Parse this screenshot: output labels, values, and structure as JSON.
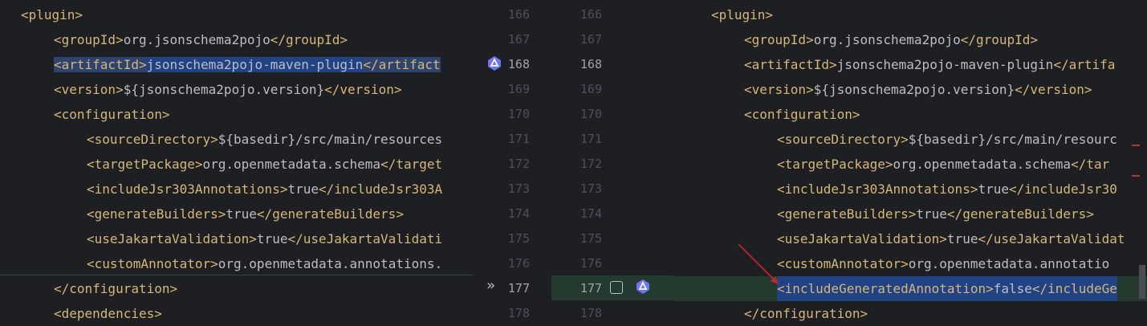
{
  "left": {
    "lines": [
      {
        "parts": [
          [
            "tag",
            "<plugin>"
          ]
        ]
      },
      {
        "parts": [
          [
            "tag",
            "<groupId>"
          ],
          [
            "text",
            "org.jsonschema2pojo"
          ],
          [
            "tag",
            "</groupId>"
          ]
        ]
      },
      {
        "parts": [
          [
            "tag",
            "<artifactId>"
          ],
          [
            "text",
            "jsonschema2pojo-maven-plugin"
          ],
          [
            "tag",
            "</artifact"
          ]
        ]
      },
      {
        "parts": [
          [
            "tag",
            "<version>"
          ],
          [
            "text",
            "${jsonschema2pojo.version}"
          ],
          [
            "tag",
            "</version>"
          ]
        ]
      },
      {
        "parts": [
          [
            "tag",
            "<configuration>"
          ]
        ]
      },
      {
        "parts": [
          [
            "tag",
            "<sourceDirectory>"
          ],
          [
            "text",
            "${basedir}/src/main/resources"
          ]
        ]
      },
      {
        "parts": [
          [
            "tag",
            "<targetPackage>"
          ],
          [
            "text",
            "org.openmetadata.schema"
          ],
          [
            "tag",
            "</target"
          ]
        ]
      },
      {
        "parts": [
          [
            "tag",
            "<includeJsr303Annotations>"
          ],
          [
            "text",
            "true"
          ],
          [
            "tag",
            "</includeJsr303A"
          ]
        ]
      },
      {
        "parts": [
          [
            "tag",
            "<generateBuilders>"
          ],
          [
            "text",
            "true"
          ],
          [
            "tag",
            "</generateBuilders>"
          ]
        ]
      },
      {
        "parts": [
          [
            "tag",
            "<useJakartaValidation>"
          ],
          [
            "text",
            "true"
          ],
          [
            "tag",
            "</useJakartaValidati"
          ]
        ]
      },
      {
        "parts": [
          [
            "tag",
            "<customAnnotator>"
          ],
          [
            "text",
            "org.openmetadata.annotations."
          ]
        ]
      },
      {
        "parts": [
          [
            "tag",
            "</configuration>"
          ]
        ]
      },
      {
        "parts": [
          [
            "tag",
            "<dependencies>"
          ]
        ]
      }
    ]
  },
  "right": {
    "lines": [
      {
        "parts": [
          [
            "tag",
            "<plugin>"
          ]
        ]
      },
      {
        "parts": [
          [
            "tag",
            "<groupId>"
          ],
          [
            "text",
            "org.jsonschema2pojo"
          ],
          [
            "tag",
            "</groupId>"
          ]
        ]
      },
      {
        "parts": [
          [
            "tag",
            "<artifactId>"
          ],
          [
            "text",
            "jsonschema2pojo-maven-plugin"
          ],
          [
            "tag",
            "</artifa"
          ]
        ]
      },
      {
        "parts": [
          [
            "tag",
            "<version>"
          ],
          [
            "text",
            "${jsonschema2pojo.version}"
          ],
          [
            "tag",
            "</version>"
          ]
        ]
      },
      {
        "parts": [
          [
            "tag",
            "<configuration>"
          ]
        ]
      },
      {
        "parts": [
          [
            "tag",
            "<sourceDirectory>"
          ],
          [
            "text",
            "${basedir}/src/main/resourc"
          ]
        ]
      },
      {
        "parts": [
          [
            "tag",
            "<targetPackage>"
          ],
          [
            "text",
            "org.openmetadata.schema"
          ],
          [
            "tag",
            "</tar"
          ]
        ]
      },
      {
        "parts": [
          [
            "tag",
            "<includeJsr303Annotations>"
          ],
          [
            "text",
            "true"
          ],
          [
            "tag",
            "</includeJsr30"
          ]
        ]
      },
      {
        "parts": [
          [
            "tag",
            "<generateBuilders>"
          ],
          [
            "text",
            "true"
          ],
          [
            "tag",
            "</generateBuilders>"
          ]
        ]
      },
      {
        "parts": [
          [
            "tag",
            "<useJakartaValidation>"
          ],
          [
            "text",
            "true"
          ],
          [
            "tag",
            "</useJakartaValidat"
          ]
        ]
      },
      {
        "parts": [
          [
            "tag",
            "<customAnnotator>"
          ],
          [
            "text",
            "org.openmetadata.annotatio"
          ]
        ]
      },
      {
        "parts": [
          [
            "tag",
            "<includeGeneratedAnnotation>"
          ],
          [
            "text",
            "false"
          ],
          [
            "tag",
            "</includeGe"
          ]
        ]
      },
      {
        "parts": [
          [
            "tag",
            "</configuration>"
          ]
        ]
      }
    ]
  },
  "gutter": {
    "left_numbers": [
      "166",
      "167",
      "168",
      "169",
      "170",
      "171",
      "172",
      "173",
      "174",
      "175",
      "176",
      "177",
      "178"
    ],
    "right_numbers": [
      "166",
      "167",
      "168",
      "169",
      "170",
      "171",
      "172",
      "173",
      "174",
      "175",
      "176",
      "177",
      "178"
    ]
  },
  "colors": {
    "tag": "#d5b778",
    "text": "#bcbec4",
    "inserted_background": "#253a2f",
    "selection": "#214283",
    "arrow": "#c0272d"
  },
  "icons": {
    "ai_assistant": "ai-assistant-icon",
    "apply_chevron": "double-chevron-right-icon",
    "accept_checkbox": "checkbox-icon"
  }
}
